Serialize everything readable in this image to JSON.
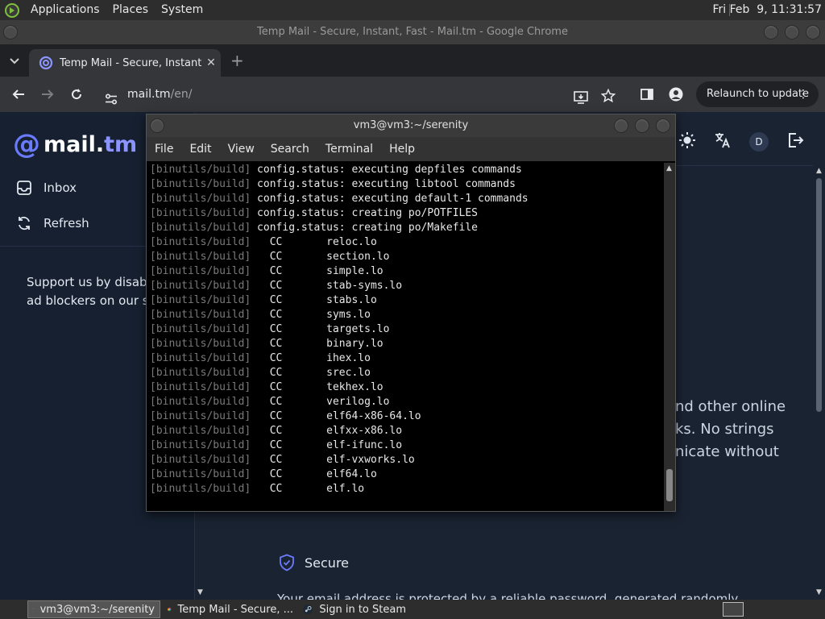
{
  "system_panel": {
    "menus": [
      "Applications",
      "Places",
      "System"
    ],
    "clock": "Fri Feb  9, 11:31:57"
  },
  "chrome": {
    "window_title": "Temp Mail - Secure, Instant, Fast - Mail.tm - Google Chrome",
    "tab_label": "Temp Mail - Secure, Instant,",
    "url_host": "mail.tm",
    "url_path": "/en/",
    "relaunch_label": "Relaunch to update"
  },
  "page": {
    "brand_name": "mail.",
    "brand_suffix": "tm",
    "sidebar": {
      "inbox": "Inbox",
      "refresh": "Refresh",
      "support_line1": "Support us by disablin",
      "support_line2": "ad blockers on our site"
    },
    "avatar_letter": "D",
    "main_lines": [
      "nd other online",
      "ks. No strings",
      "nicate without"
    ],
    "feature_secure": "Secure",
    "cut_text": "Your email address is protected by a reliable password, generated randomly"
  },
  "terminal": {
    "title": "vm3@vm3:~/serenity",
    "menu": [
      "File",
      "Edit",
      "View",
      "Search",
      "Terminal",
      "Help"
    ],
    "prefix": "[binutils/build]",
    "lines": [
      " config.status: executing depfiles commands",
      " config.status: executing libtool commands",
      " config.status: executing default-1 commands",
      " config.status: creating po/POTFILES",
      " config.status: creating po/Makefile",
      "   CC       reloc.lo",
      "   CC       section.lo",
      "   CC       simple.lo",
      "   CC       stab-syms.lo",
      "   CC       stabs.lo",
      "   CC       syms.lo",
      "   CC       targets.lo",
      "   CC       binary.lo",
      "   CC       ihex.lo",
      "   CC       srec.lo",
      "   CC       tekhex.lo",
      "   CC       verilog.lo",
      "   CC       elf64-x86-64.lo",
      "   CC       elfxx-x86.lo",
      "   CC       elf-ifunc.lo",
      "   CC       elf-vxworks.lo",
      "   CC       elf64.lo",
      "   CC       elf.lo"
    ]
  },
  "taskbar": {
    "tasks": [
      "vm3@vm3:~/serenity",
      "Temp Mail - Secure, ...",
      "Sign in to Steam"
    ]
  }
}
